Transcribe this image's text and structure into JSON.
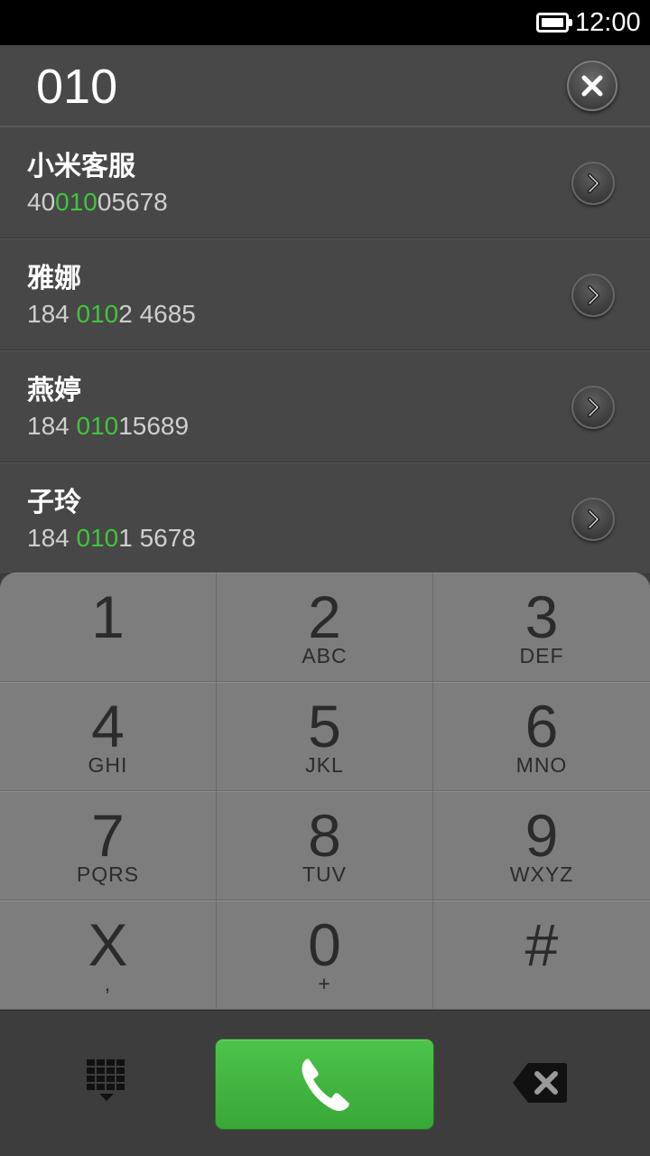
{
  "status_bar": {
    "time": "12:00",
    "battery_icon": "battery-full-icon"
  },
  "dial_input": {
    "value": "010",
    "clear_icon": "clear-x-icon"
  },
  "contacts": [
    {
      "name": "小米客服",
      "number_pre": "40",
      "number_match": "010",
      "number_post": "05678"
    },
    {
      "name": "雅娜",
      "number_pre": "184 ",
      "number_match": "010",
      "number_post": "2 4685"
    },
    {
      "name": "燕婷",
      "number_pre": "184 ",
      "number_match": "010",
      "number_post": "15689"
    },
    {
      "name": "子玲",
      "number_pre": "184 ",
      "number_match": "010",
      "number_post": "1 5678"
    }
  ],
  "keypad": {
    "keys": [
      {
        "digit": "1",
        "letters": ""
      },
      {
        "digit": "2",
        "letters": "ABC"
      },
      {
        "digit": "3",
        "letters": "DEF"
      },
      {
        "digit": "4",
        "letters": "GHI"
      },
      {
        "digit": "5",
        "letters": "JKL"
      },
      {
        "digit": "6",
        "letters": "MNO"
      },
      {
        "digit": "7",
        "letters": "PQRS"
      },
      {
        "digit": "8",
        "letters": "TUV"
      },
      {
        "digit": "9",
        "letters": "WXYZ"
      },
      {
        "digit": "X",
        "letters": ","
      },
      {
        "digit": "0",
        "letters": "+"
      },
      {
        "digit": "#",
        "letters": ""
      }
    ]
  },
  "bottom_bar": {
    "keypad_toggle_icon": "dialpad-grid-icon",
    "call_icon": "phone-handset-icon",
    "backspace_icon": "backspace-icon"
  },
  "colors": {
    "match_highlight": "#3ec63a",
    "call_button": "#43bb41",
    "keypad_bg": "#7c7c7c",
    "list_bg": "#474747"
  }
}
